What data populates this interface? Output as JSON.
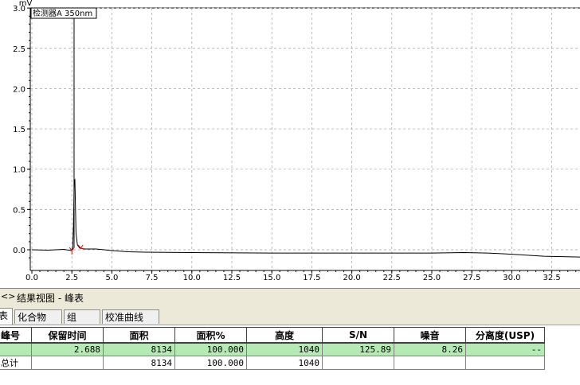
{
  "chart_data": {
    "type": "line",
    "ylabel": "mV",
    "legend": "检测器A 350nm",
    "x_ticks": [
      "0.0",
      "2.5",
      "5.0",
      "7.5",
      "10.0",
      "12.5",
      "15.0",
      "17.5",
      "20.0",
      "22.5",
      "25.0",
      "27.5",
      "30.0",
      "32.5"
    ],
    "y_ticks": [
      "0.0",
      "0.5",
      "1.0",
      "1.5",
      "2.0",
      "2.5",
      "3.0"
    ],
    "xlim": [
      0,
      34.3
    ],
    "ylim": [
      -0.15,
      3.02
    ],
    "peak": {
      "retention_time": 2.688,
      "height": 0.87
    },
    "series": [
      {
        "points": [
          [
            0,
            0.0
          ],
          [
            1.0,
            -0.005
          ],
          [
            2.0,
            0.005
          ],
          [
            2.45,
            -0.01
          ],
          [
            2.55,
            0.02
          ],
          [
            2.6,
            0.3
          ],
          [
            2.65,
            0.86
          ],
          [
            2.688,
            0.87
          ],
          [
            2.72,
            0.6
          ],
          [
            2.76,
            0.2
          ],
          [
            2.85,
            0.06
          ],
          [
            3.0,
            0.02
          ],
          [
            3.3,
            0.01
          ],
          [
            4.0,
            0.01
          ],
          [
            5.0,
            -0.01
          ],
          [
            6.0,
            -0.025
          ],
          [
            7.0,
            -0.03
          ],
          [
            10.0,
            -0.035
          ],
          [
            15.0,
            -0.04
          ],
          [
            20.0,
            -0.04
          ],
          [
            25.0,
            -0.04
          ],
          [
            27.0,
            -0.035
          ],
          [
            28.5,
            -0.04
          ],
          [
            30.0,
            -0.055
          ],
          [
            32.0,
            -0.08
          ],
          [
            34.3,
            -0.09
          ]
        ]
      }
    ]
  },
  "results": {
    "expander": "<>",
    "title": "结果视图 -  峰表"
  },
  "tabs": [
    {
      "label": "表"
    },
    {
      "label": "化合物"
    },
    {
      "label": "组"
    },
    {
      "label": "校准曲线"
    }
  ],
  "table": {
    "headers": [
      "峰号",
      "保留时间",
      "面积",
      "面积%",
      "高度",
      "S/N",
      "噪音",
      "分离度(USP)"
    ],
    "rows": [
      [
        "",
        "2.688",
        "8134",
        "100.000",
        "1040",
        "125.89",
        "8.26",
        "--"
      ],
      [
        "总计",
        "",
        "8134",
        "100.000",
        "1040",
        "",
        "",
        ""
      ]
    ]
  }
}
